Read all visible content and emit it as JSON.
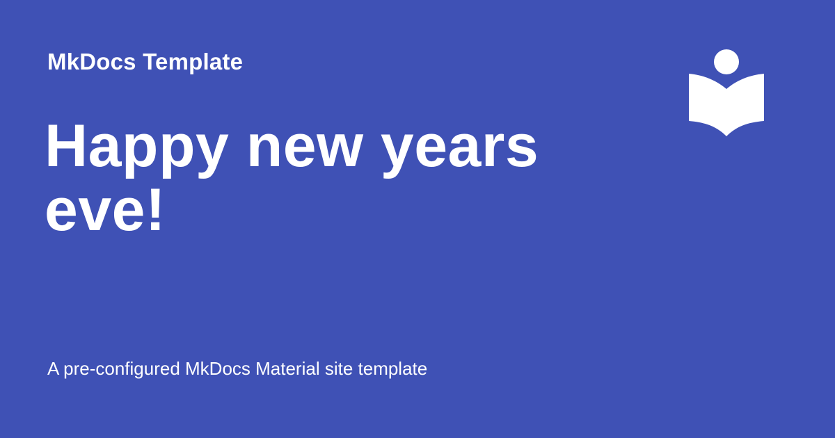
{
  "colors": {
    "background": "#3f51b5",
    "foreground": "#ffffff"
  },
  "site": {
    "name": "MkDocs Template",
    "logo_icon": "book-reader-icon"
  },
  "page": {
    "title": "Happy new years eve!",
    "description": "A pre-configured MkDocs Material site template"
  }
}
